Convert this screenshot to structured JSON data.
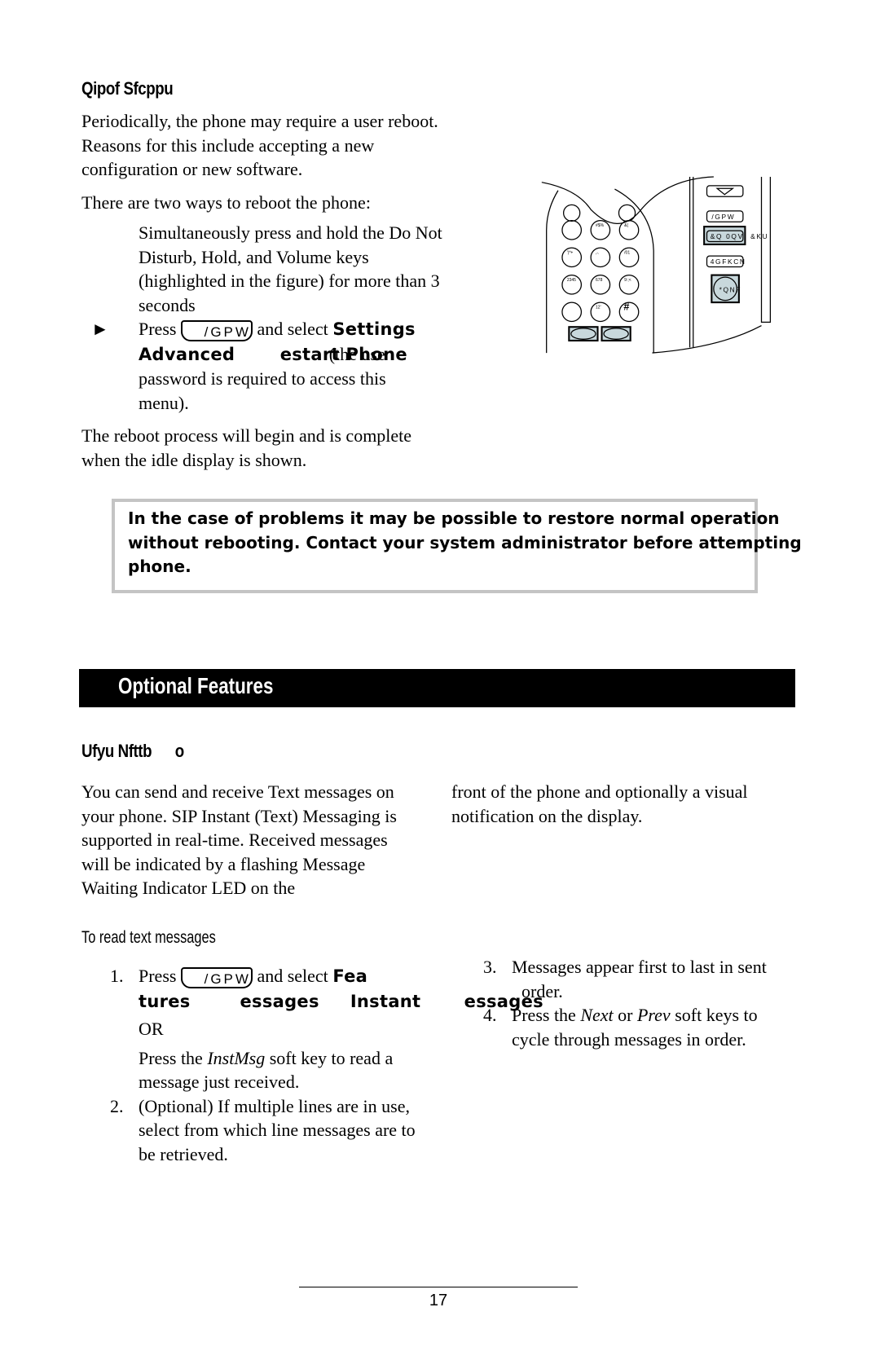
{
  "reboot": {
    "heading": "Qipof Sfcppu",
    "para1": "Periodically, the phone may require a user reboot.  Reasons for this include accepting a new configuration or new software.",
    "para2": "There are two ways to reboot the phone:",
    "bullet1_marker": "",
    "bullet1": "Simultaneously press and hold the Do Not Disturb, Hold, and Volume keys (highlighted in the figure) for more than 3 seconds",
    "bullet2_marker": "►",
    "bullet2_pre": "Press",
    "key_label": "/GPW",
    "bullet2_mid": "and select",
    "bullet2_bold1": "Settings",
    "bullet2_bold2": "Advanced",
    "bullet2_bold3": "estart Phone",
    "bullet2_overlap": "(the use",
    "bullet2_post": "password is required to access this menu).",
    "para3": "The reboot process will begin and is complete when the idle display is shown."
  },
  "phone_figure": {
    "keys": [
      "/GPW",
      "&Q 0QV",
      "&KU",
      "4GFKCN",
      "*QNF"
    ],
    "pad_labels": [
      "#$%",
      "&(",
      "')*+",
      ",-.",
      "/01",
      "2345",
      "678",
      "9:;<",
      "12'"
    ],
    "hash_key": "#"
  },
  "notice": {
    "line1": "In the case of problems    it may be possible to restore normal  operation",
    "line2": "without rebooting.  Contact your system administrator before  attempting",
    "line3": "phone."
  },
  "banner": {
    "title": "Optional Features"
  },
  "text_messaging": {
    "heading": "Ufyu Nfttb      o",
    "col_left": "You can send and receive Text messages on your phone.  SIP Instant (Text) Messaging is supported in real-time.  Received messages will be indicated by a flashing Message Waiting Indicator LED on the",
    "col_right": "front of the phone and optionally a visual notification on the display.",
    "subheading": "To read text messages",
    "steps": [
      {
        "num": "1.",
        "pre": "Press",
        "key": "/GPW",
        "mid": "and select",
        "bold1": "Fea",
        "bold2": "tures        essages     Instant       essages",
        "or": "OR",
        "alt_pre": "Press the ",
        "alt_em": "InstMsg",
        "alt_post": " soft key to read a message just received."
      },
      {
        "num": "2.",
        "text": "(Optional)  If multiple lines are in use, select from which line messages are to be retrieved."
      },
      {
        "num": "3.",
        "text": "Messages appear first to last in sent",
        "overflow": "order."
      },
      {
        "num": "4.",
        "pre": "Press the ",
        "em1": "Next",
        "mid": " or ",
        "em2": "Prev",
        "post": " soft keys to cycle through messages in order."
      }
    ]
  },
  "footer": {
    "page_number": "17"
  }
}
